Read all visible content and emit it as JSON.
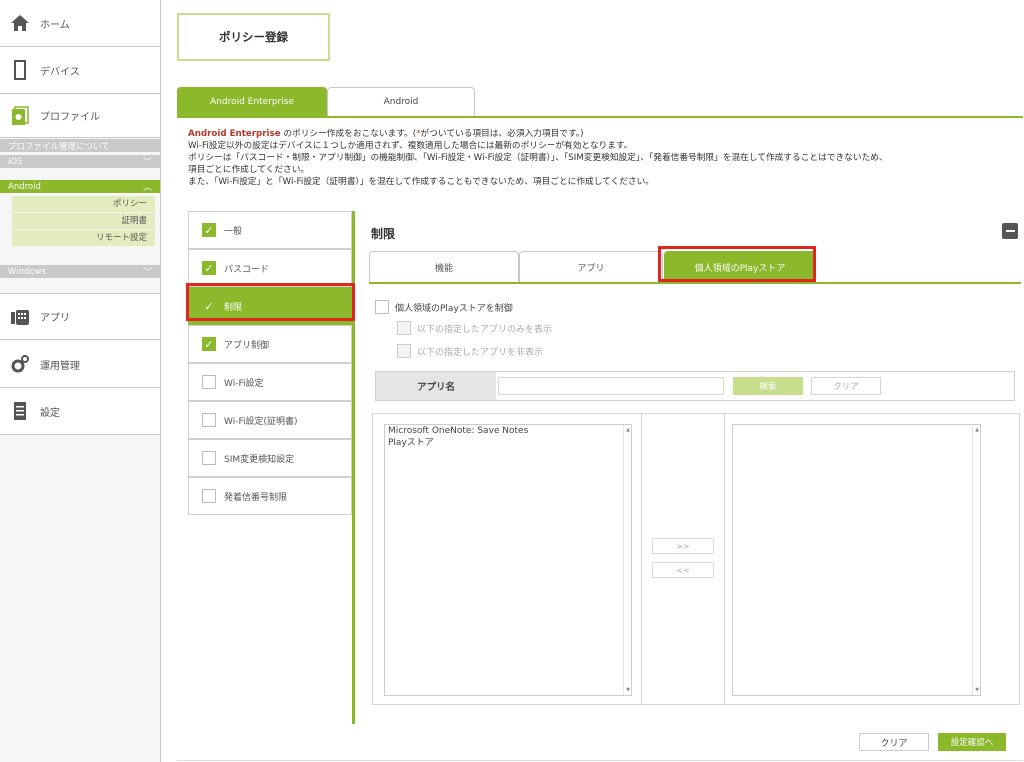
{
  "sidebar": {
    "home": "ホーム",
    "device": "デバイス",
    "profile": "プロファイル",
    "profile_about": "プロファイル管理について",
    "ios": "iOS",
    "android": "Android",
    "android_sub": [
      "ポリシー",
      "証明書",
      "リモート設定"
    ],
    "windows": "Windows",
    "app": "アプリ",
    "operations": "運用管理",
    "settings": "設定"
  },
  "header": {
    "title": "ポリシー登録"
  },
  "tabs": [
    "Android Enterprise",
    "Android"
  ],
  "intro": {
    "brand": "Android Enterprise",
    "line1_a": " のポリシー作成をおこないます。(",
    "line1_star": "*",
    "line1_b": "がついている項目は、必須入力項目です。)",
    "line2": "Wi-Fi設定以外の設定はデバイスに１つしか適用されず、複数適用した場合には最新のポリシーが有効となります。",
    "line3": "ポリシーは「パスコード・制限・アプリ制御」の機能制御、「Wi-Fi設定・Wi-Fi設定（証明書）」、「SIM変更検知設定」、「発着信番号制限」を混在して作成することはできないため、",
    "line4": "項目ごとに作成してください。",
    "line5": "また、「Wi-Fi設定」と「Wi-Fi設定（証明書）」を混在して作成することもできないため、項目ごとに作成してください。"
  },
  "items": [
    {
      "label": "一般",
      "checked": true
    },
    {
      "label": "パスコード",
      "checked": true
    },
    {
      "label": "制限",
      "checked": true,
      "active": true
    },
    {
      "label": "アプリ制御",
      "checked": true
    },
    {
      "label": "Wi-Fi設定",
      "checked": false
    },
    {
      "label": "Wi-Fi設定(証明書)",
      "checked": false
    },
    {
      "label": "SIM変更検知設定",
      "checked": false
    },
    {
      "label": "発着信番号制限",
      "checked": false
    }
  ],
  "panel": {
    "title": "制限",
    "subtabs": [
      "機能",
      "アプリ",
      "個人領域のPlayストア"
    ],
    "opt_main": "個人領域のPlayストアを制御",
    "opt_show": "以下の指定したアプリのみを表示",
    "opt_hide": "以下の指定したアプリを非表示",
    "app_name_label": "アプリ名",
    "search_button": "検索",
    "clear_button": "クリア",
    "left_list": [
      "Microsoft OneNote: Save Notes",
      "Playストア"
    ],
    "right_list": [],
    "move_right": ">>",
    "move_left": "<<"
  },
  "footer": {
    "clear": "クリア",
    "confirm": "設定確認へ"
  },
  "colors": {
    "accent": "#8cb82b",
    "highlight": "#e0261f",
    "brand_text": "#b1392c"
  }
}
